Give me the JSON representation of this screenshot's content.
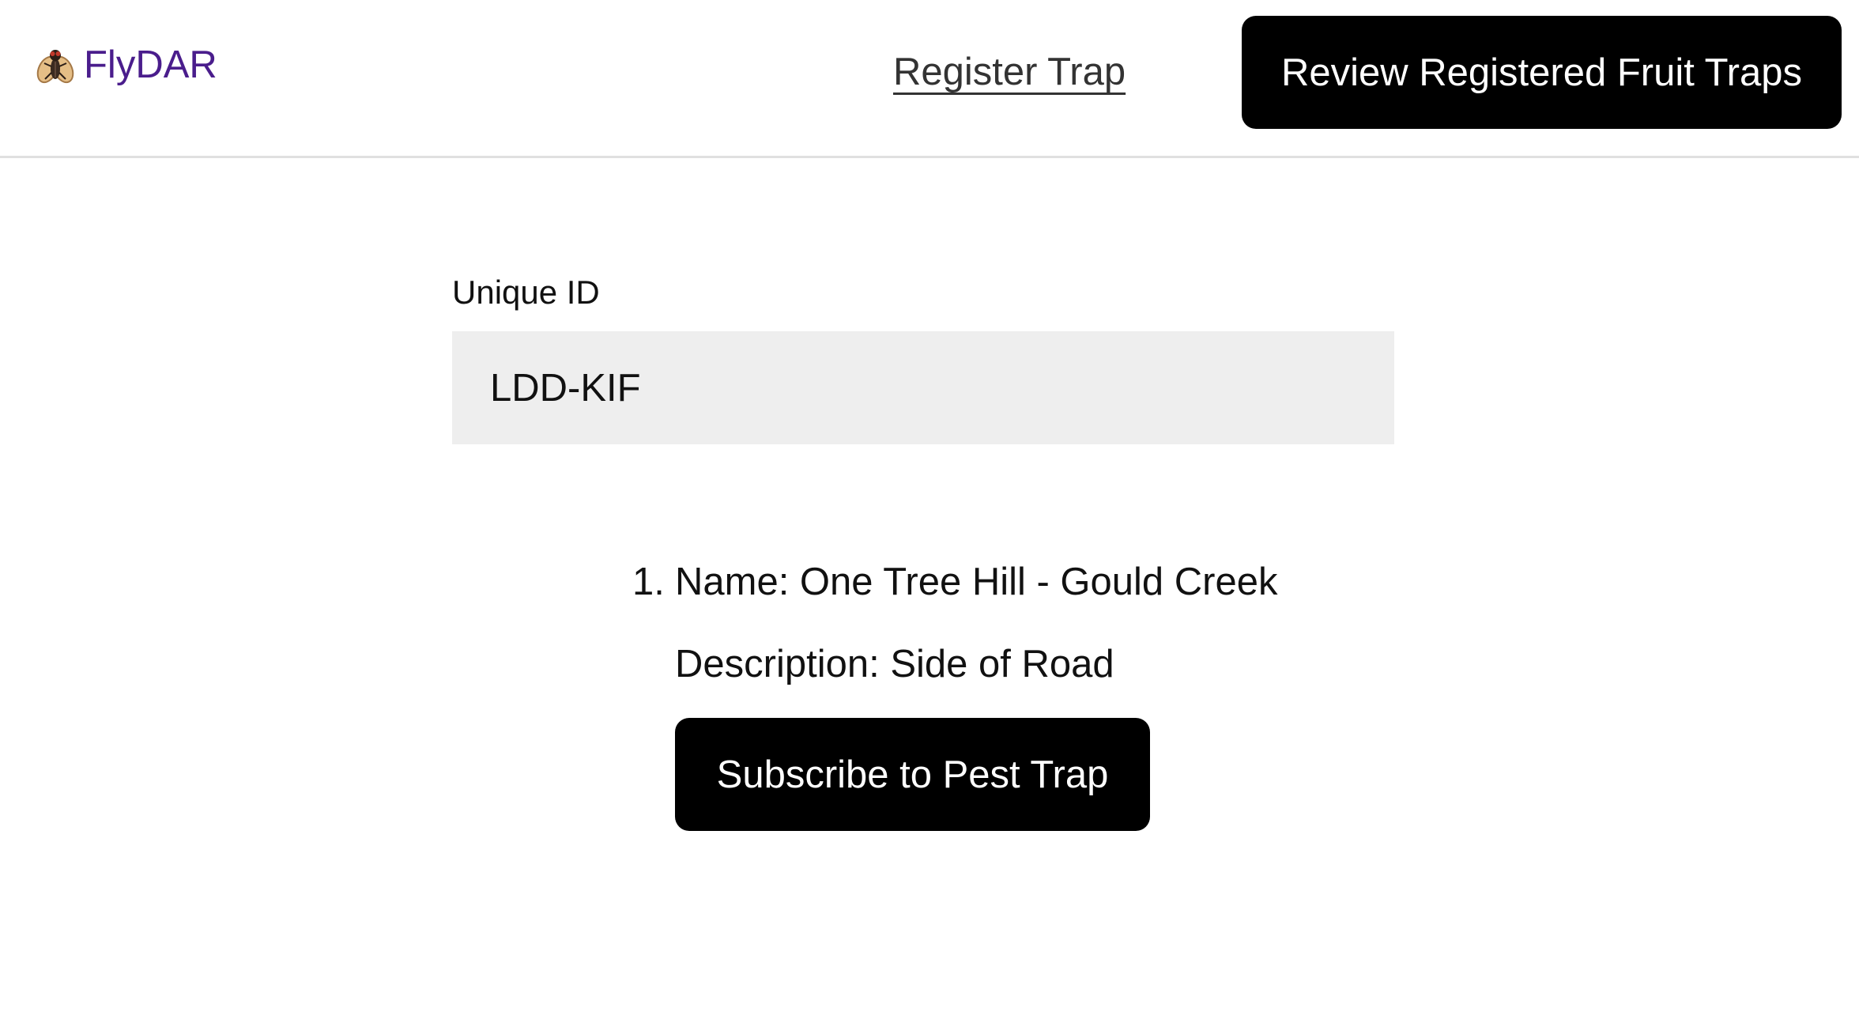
{
  "header": {
    "brand_name": "FlyDAR",
    "brand_icon": "fly-icon",
    "register_link_label": "Register Trap",
    "review_button_label": "Review Registered Fruit Traps"
  },
  "form": {
    "unique_id_label": "Unique ID",
    "unique_id_value": "LDD-KIF"
  },
  "results": [
    {
      "number": "1.",
      "name_line": "Name: One Tree Hill - Gould Creek",
      "description_line": "Description: Side of Road",
      "subscribe_label": "Subscribe to Pest Trap"
    }
  ],
  "colors": {
    "brand": "#4a1d8c",
    "primary_button_bg": "#000000",
    "primary_button_text": "#ffffff",
    "input_bg": "#eeeeee",
    "divider": "#e0e0e0"
  }
}
